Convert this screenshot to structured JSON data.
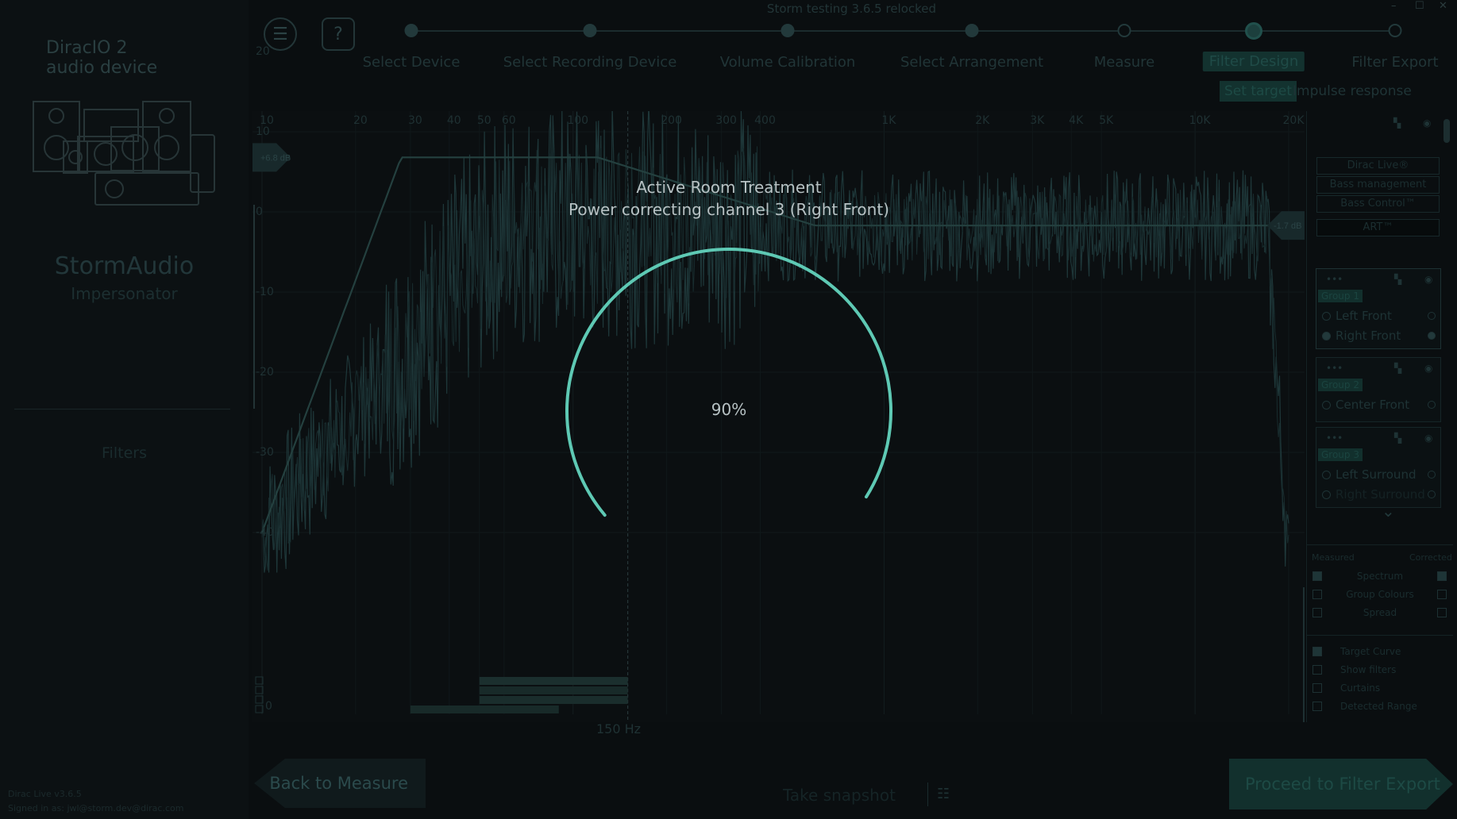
{
  "window": {
    "title": "Storm testing 3.6.5 relocked",
    "controls": [
      "–",
      "☐",
      "✕"
    ]
  },
  "sidebar": {
    "app_title_line1": "DiracIO 2",
    "app_title_line2": "audio device",
    "brand": "StormAudio",
    "product": "Impersonator",
    "filters_label": "Filters",
    "version": "Dirac Live v3.6.5",
    "signed_in": "Signed in as: jwl@storm.dev@dirac.com"
  },
  "toolbar": {
    "menu_icon": "☰",
    "help_icon": "?"
  },
  "wizard": {
    "steps": [
      {
        "label": "Select Device",
        "state": "done"
      },
      {
        "label": "Select Recording Device",
        "state": "done"
      },
      {
        "label": "Volume Calibration",
        "state": "done"
      },
      {
        "label": "Select Arrangement",
        "state": "done"
      },
      {
        "label": "Measure",
        "state": "visited"
      },
      {
        "label": "Filter Design",
        "state": "current"
      },
      {
        "label": "Filter Export",
        "state": "pending"
      }
    ],
    "subtabs": [
      {
        "label": "Set target",
        "active": true
      },
      {
        "label": "Impulse response",
        "active": false
      }
    ]
  },
  "graph": {
    "freq_ticks": [
      "10",
      "20",
      "30",
      "40",
      "50",
      "60",
      "100",
      "200",
      "300",
      "400",
      "1K",
      "2K",
      "3K",
      "4K",
      "5K",
      "10K",
      "20K"
    ],
    "db_ticks": [
      "20",
      "10",
      "0",
      "-10",
      "-20",
      "-30",
      "-40"
    ],
    "bottom_zero_label": "0",
    "cursor_readout": "150 Hz",
    "left_handle_label": "+6.8 dB",
    "right_handle_label": "-1.7 dB",
    "colors": {
      "curve": "#1e3739",
      "target": "#24403f",
      "ring": "#5ec9b4"
    }
  },
  "overlay": {
    "title": "Active Room Treatment",
    "subtitle": "Power correcting channel 3 (Right Front)",
    "progress_text": "90%",
    "progress": 0.9
  },
  "right_panel": {
    "features": [
      "Dirac Live®",
      "Bass management",
      "Bass Control™",
      "ART™"
    ],
    "groups": [
      {
        "badge": "Group 1",
        "channels": [
          {
            "name": "Left Front",
            "selected": false
          },
          {
            "name": "Right Front",
            "selected": true
          }
        ]
      },
      {
        "badge": "Group 2",
        "channels": [
          {
            "name": "Center Front",
            "selected": false
          }
        ]
      },
      {
        "badge": "Group 3",
        "channels": [
          {
            "name": "Left Surround",
            "selected": false
          },
          {
            "name": "Right Surround",
            "selected": false
          }
        ]
      }
    ],
    "options_header_left": "Measured",
    "options_header_right": "Corrected",
    "options_dual": [
      {
        "label": "Spectrum",
        "measured": true,
        "corrected": true
      },
      {
        "label": "Group Colours",
        "measured": false,
        "corrected": false
      },
      {
        "label": "Spread",
        "measured": false,
        "corrected": false
      }
    ],
    "options_single": [
      {
        "label": "Target Curve",
        "checked": true
      },
      {
        "label": "Show filters",
        "checked": false
      },
      {
        "label": "Curtains",
        "checked": false
      },
      {
        "label": "Detected Range",
        "checked": false
      }
    ],
    "scroll_down_icon": "⌄"
  },
  "footer": {
    "back_label": "Back to Measure",
    "snapshot_label": "Take snapshot",
    "proceed_label": "Proceed to Filter Export"
  }
}
